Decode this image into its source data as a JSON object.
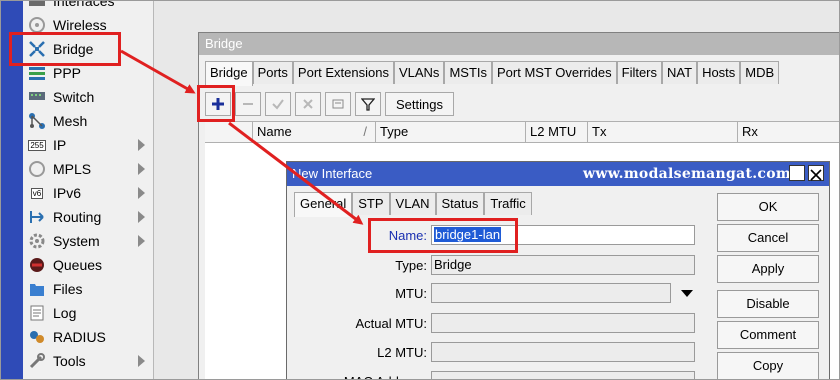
{
  "sidebar": {
    "items": [
      {
        "label": "Interfaces",
        "icon": "interfaces-icon"
      },
      {
        "label": "Wireless",
        "icon": "wireless-icon"
      },
      {
        "label": "Bridge",
        "icon": "bridge-icon"
      },
      {
        "label": "PPP",
        "icon": "ppp-icon"
      },
      {
        "label": "Switch",
        "icon": "switch-icon"
      },
      {
        "label": "Mesh",
        "icon": "mesh-icon"
      },
      {
        "label": "IP",
        "icon": "ip-icon"
      },
      {
        "label": "MPLS",
        "icon": "mpls-icon"
      },
      {
        "label": "IPv6",
        "icon": "ipv6-icon"
      },
      {
        "label": "Routing",
        "icon": "routing-icon"
      },
      {
        "label": "System",
        "icon": "system-icon"
      },
      {
        "label": "Queues",
        "icon": "queues-icon"
      },
      {
        "label": "Files",
        "icon": "files-icon"
      },
      {
        "label": "Log",
        "icon": "log-icon"
      },
      {
        "label": "RADIUS",
        "icon": "radius-icon"
      },
      {
        "label": "Tools",
        "icon": "tools-icon"
      }
    ],
    "ip_icon_text": "255",
    "ipv6_icon_text": "v6"
  },
  "bridge_window": {
    "title": "Bridge",
    "tabs": [
      "Bridge",
      "Ports",
      "Port Extensions",
      "VLANs",
      "MSTIs",
      "Port MST Overrides",
      "Filters",
      "NAT",
      "Hosts",
      "MDB"
    ],
    "settings_label": "Settings",
    "columns": [
      "Name",
      "Type",
      "L2 MTU",
      "Tx",
      "Rx"
    ]
  },
  "dialog": {
    "title": "New Interface",
    "watermark": "www.modalsemangat.com",
    "tabs": [
      "General",
      "STP",
      "VLAN",
      "Status",
      "Traffic"
    ],
    "fields": {
      "name_label": "Name:",
      "name_value": "bridge1-lan",
      "type_label": "Type:",
      "type_value": "Bridge",
      "mtu_label": "MTU:",
      "actual_mtu_label": "Actual MTU:",
      "l2mtu_label": "L2 MTU:",
      "mac_label": "MAC Address:"
    },
    "buttons": [
      "OK",
      "Cancel",
      "Apply",
      "Disable",
      "Comment",
      "Copy"
    ]
  },
  "colors": {
    "sidebar_strip": "#2f4bb7",
    "dialog_title": "#3a5cc4",
    "highlight": "#e02020",
    "selection": "#1f5bd6"
  }
}
